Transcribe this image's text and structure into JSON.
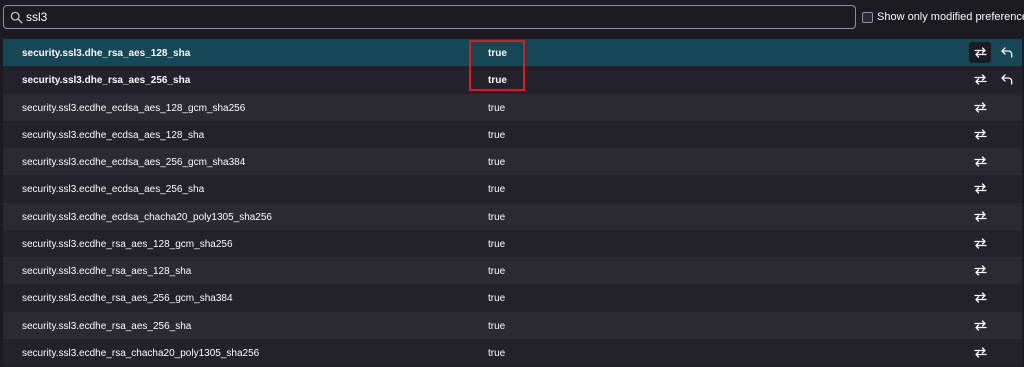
{
  "search": {
    "value": "ssl3",
    "icon": "search-icon"
  },
  "filter": {
    "label": "Show only modified preferences"
  },
  "colors": {
    "highlight_box": "#e0191f",
    "selected_row": "#164756"
  },
  "rows": [
    {
      "name": "security.ssl3.dhe_rsa_aes_128_sha",
      "value": "true",
      "modified": true,
      "selected": true
    },
    {
      "name": "security.ssl3.dhe_rsa_aes_256_sha",
      "value": "true",
      "modified": true,
      "selected": false
    },
    {
      "name": "security.ssl3.ecdhe_ecdsa_aes_128_gcm_sha256",
      "value": "true",
      "modified": false,
      "selected": false
    },
    {
      "name": "security.ssl3.ecdhe_ecdsa_aes_128_sha",
      "value": "true",
      "modified": false,
      "selected": false
    },
    {
      "name": "security.ssl3.ecdhe_ecdsa_aes_256_gcm_sha384",
      "value": "true",
      "modified": false,
      "selected": false
    },
    {
      "name": "security.ssl3.ecdhe_ecdsa_aes_256_sha",
      "value": "true",
      "modified": false,
      "selected": false
    },
    {
      "name": "security.ssl3.ecdhe_ecdsa_chacha20_poly1305_sha256",
      "value": "true",
      "modified": false,
      "selected": false
    },
    {
      "name": "security.ssl3.ecdhe_rsa_aes_128_gcm_sha256",
      "value": "true",
      "modified": false,
      "selected": false
    },
    {
      "name": "security.ssl3.ecdhe_rsa_aes_128_sha",
      "value": "true",
      "modified": false,
      "selected": false
    },
    {
      "name": "security.ssl3.ecdhe_rsa_aes_256_gcm_sha384",
      "value": "true",
      "modified": false,
      "selected": false
    },
    {
      "name": "security.ssl3.ecdhe_rsa_aes_256_sha",
      "value": "true",
      "modified": false,
      "selected": false
    },
    {
      "name": "security.ssl3.ecdhe_rsa_chacha20_poly1305_sha256",
      "value": "true",
      "modified": false,
      "selected": false
    }
  ]
}
